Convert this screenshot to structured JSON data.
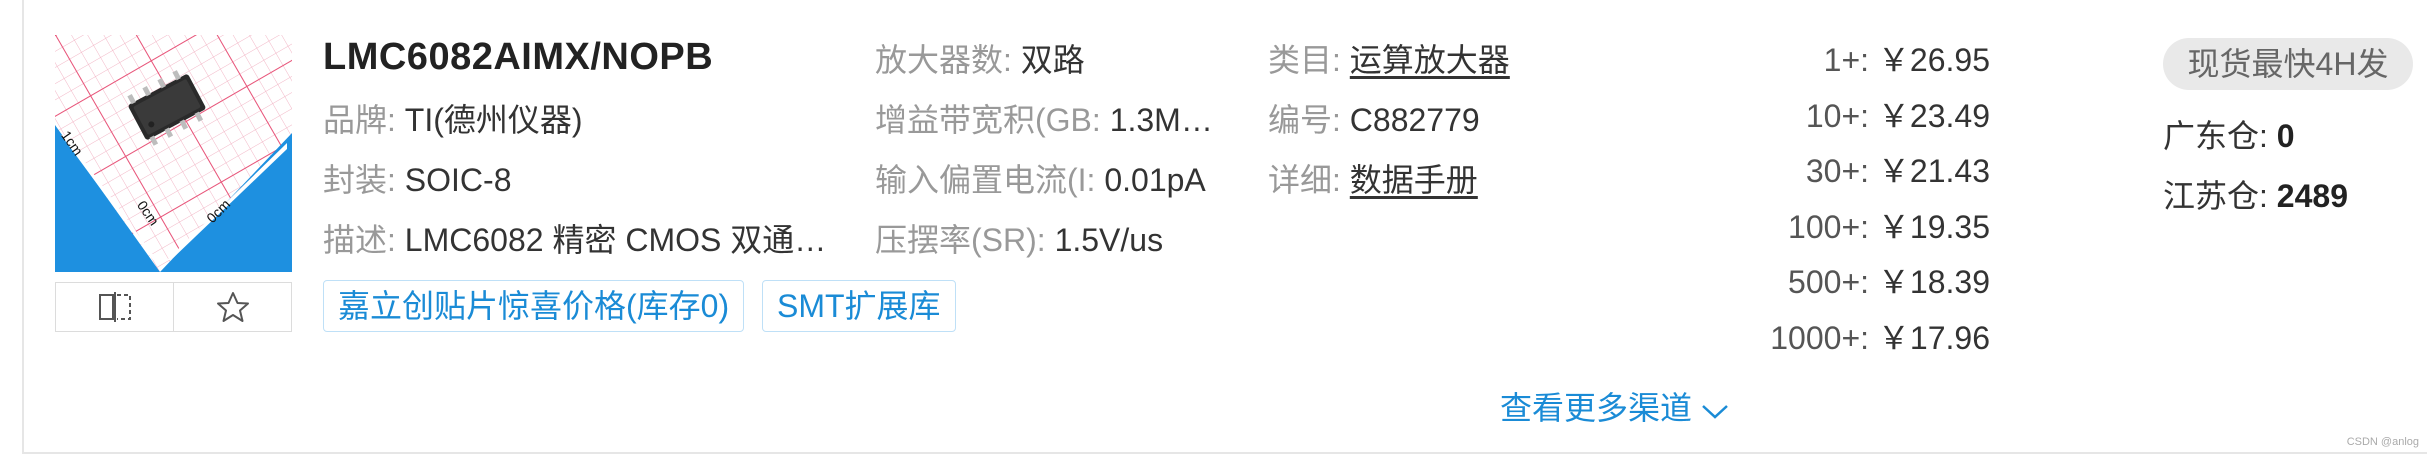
{
  "product": {
    "name": "LMC6082AIMX/NOPB",
    "brand_label": "品牌:",
    "brand_value": "TI(德州仪器)",
    "package_label": "封装:",
    "package_value": "SOIC-8",
    "desc_label": "描述:",
    "desc_value": "LMC6082 精密 CMOS 双通…",
    "amp_count_label": "放大器数:",
    "amp_count_value": "双路",
    "gbw_label": "增益带宽积(GB:",
    "gbw_value": "1.3M…",
    "ibias_label": "输入偏置电流(I:",
    "ibias_value": "0.01pA",
    "slew_label": "压摆率(SR):",
    "slew_value": "1.5V/us",
    "category_label": "类目:",
    "category_value": "运算放大器",
    "code_label": "编号:",
    "code_value": "C882779",
    "detail_label": "详细:",
    "detail_value": "数据手册"
  },
  "thumbnail": {
    "ruler_label_1": "1cm",
    "ruler_label_2": "0cm",
    "ruler_label_3": "0cm",
    "grid_color": "#e8557a",
    "ruler_color": "#1e90e0"
  },
  "tags": {
    "promo": "嘉立创贴片惊喜价格(库存0)",
    "smt": "SMT扩展库"
  },
  "prices": [
    {
      "qty": "1+:",
      "price": "￥26.95"
    },
    {
      "qty": "10+:",
      "price": "￥23.49"
    },
    {
      "qty": "30+:",
      "price": "￥21.43"
    },
    {
      "qty": "100+:",
      "price": "￥19.35"
    },
    {
      "qty": "500+:",
      "price": "￥18.39"
    },
    {
      "qty": "1000+:",
      "price": "￥17.96"
    }
  ],
  "stock": {
    "badge": "现货最快4H发",
    "gd_label": "广东仓:",
    "gd_value": "0",
    "js_label": "江苏仓:",
    "js_value": "2489"
  },
  "more_channels": "查看更多渠道",
  "watermark": "CSDN @anlog",
  "colors": {
    "link_blue": "#1a8bd6",
    "label_gray": "#999999",
    "text_dark": "#333333",
    "badge_bg": "#e9e9e9"
  }
}
